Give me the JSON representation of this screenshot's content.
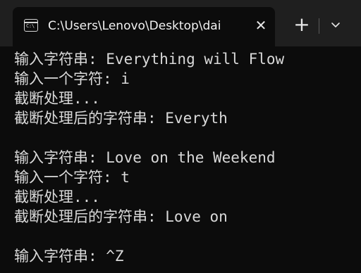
{
  "window": {
    "tab_title": "C:\\Users\\Lenovo\\Desktop\\dai",
    "tab_icon_text": "C:\\"
  },
  "controls": {
    "close_glyph": "✕",
    "new_tab_glyph": "+"
  },
  "terminal": {
    "lines": [
      "输入字符串: Everything will Flow",
      "输入一个字符: i",
      "截断处理...",
      "截断处理后的字符串: Everyth",
      "",
      "输入字符串: Love on the Weekend",
      "输入一个字符: t",
      "截断处理...",
      "截断处理后的字符串: Love on",
      "",
      "输入字符串: ^Z"
    ]
  }
}
